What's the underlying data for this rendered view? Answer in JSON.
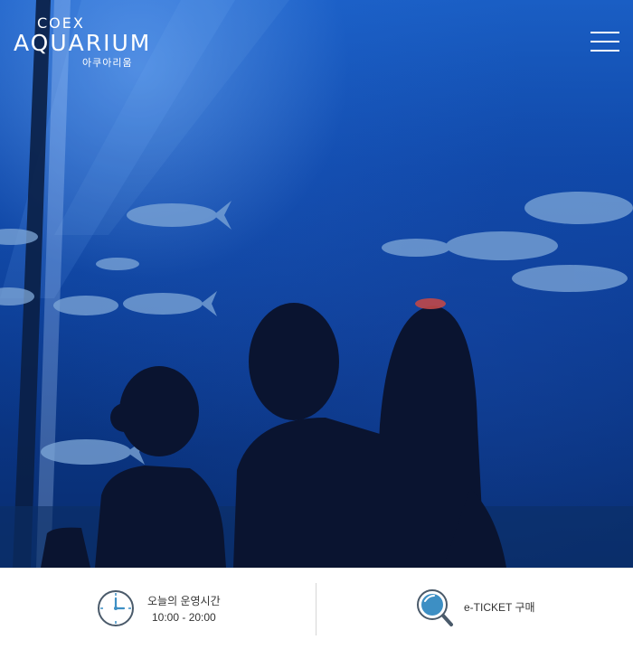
{
  "header": {
    "logo": {
      "top": "COEX",
      "main": "AQUARIUM",
      "sub": "아쿠아리움"
    },
    "menu_icon": "hamburger-menu-icon"
  },
  "hero": {
    "image": "aquarium-visitors-viewing-fish-tank-photo"
  },
  "info_bar": {
    "hours": {
      "icon": "clock-icon",
      "title": "오늘의 운영시간",
      "time": "10:00 - 20:00"
    },
    "ticket": {
      "icon": "search-icon",
      "label": "e-TICKET 구매"
    }
  },
  "colors": {
    "water_top": "#1a5ec4",
    "water_bottom": "#082c6e",
    "icon_blue": "#3d8fc4",
    "icon_stroke": "#4a5a6a",
    "text": "#333333",
    "divider": "#d6d6d6"
  }
}
